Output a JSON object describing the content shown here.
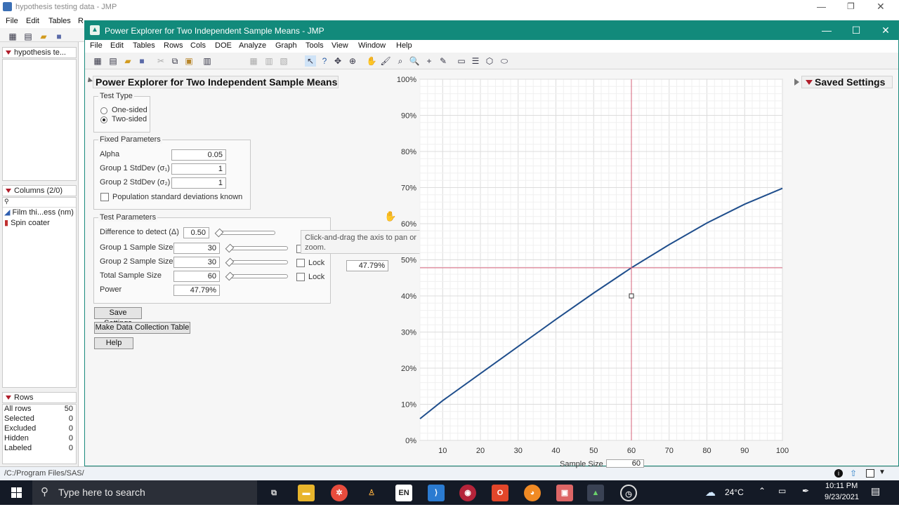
{
  "bg_window": {
    "title": "hypothesis testing data - JMP",
    "menu": [
      "File",
      "Edit",
      "Tables",
      "R"
    ],
    "left_panels": {
      "table_name": "hypothesis te...",
      "columns_header": "Columns (2/0)",
      "columns": [
        "Film thi...ess (nm)",
        "Spin coater"
      ],
      "rows_header": "Rows",
      "rows": [
        {
          "label": "All rows",
          "value": "50"
        },
        {
          "label": "Selected",
          "value": "0"
        },
        {
          "label": "Excluded",
          "value": "0"
        },
        {
          "label": "Hidden",
          "value": "0"
        },
        {
          "label": "Labeled",
          "value": "0"
        }
      ]
    },
    "status_path": "/C:/Program Files/SAS/"
  },
  "window": {
    "title": "Power Explorer for Two Independent Sample Means - JMP",
    "menu": [
      "File",
      "Edit",
      "Tables",
      "Rows",
      "Cols",
      "DOE",
      "Analyze",
      "Graph",
      "Tools",
      "View",
      "Window",
      "Help"
    ],
    "controls": {
      "minimize": "—",
      "maximize": "☐",
      "close": "✕"
    }
  },
  "report": {
    "title": "Power Explorer for Two Independent Sample Means",
    "test_type": {
      "title": "Test Type",
      "one_sided": "One-sided",
      "two_sided": "Two-sided",
      "selected": "Two-sided"
    },
    "fixed": {
      "title": "Fixed Parameters",
      "alpha_label": "Alpha",
      "alpha": "0.05",
      "sd1_label": "Group 1 StdDev (σ₁)",
      "sd1": "1",
      "sd2_label": "Group 2 StdDev (σ₂)",
      "sd2": "1",
      "known_label": "Population standard deviations known"
    },
    "test_params": {
      "title": "Test Parameters",
      "diff_label": "Difference to detect (Δ)",
      "diff": "0.50",
      "n1_label": "Group 1 Sample Size",
      "n1": "30",
      "n2_label": "Group 2 Sample Size",
      "n2": "30",
      "total_label": "Total Sample Size",
      "total": "60",
      "power_label": "Power",
      "power": "47.79%",
      "lock": "Lock"
    },
    "buttons": {
      "save": "Save Settings",
      "make": "Make Data Collection Table",
      "help": "Help"
    },
    "tooltip": "Click-and-drag the axis to pan or zoom.",
    "readout": "47.79%",
    "saved_settings": "Saved Settings"
  },
  "chart_data": {
    "type": "line",
    "xlabel": "Sample Size",
    "x_readout": "60",
    "xlim": [
      4,
      100
    ],
    "ylim": [
      0,
      100
    ],
    "x_ticks": [
      10,
      20,
      30,
      40,
      50,
      60,
      70,
      80,
      90,
      100
    ],
    "y_ticks": [
      "0%",
      "10%",
      "20%",
      "30%",
      "40%",
      "50%",
      "60%",
      "70%",
      "80%",
      "90%",
      "100%"
    ],
    "series": [
      {
        "x": [
          4,
          10,
          20,
          30,
          40,
          50,
          60,
          70,
          80,
          90,
          100
        ],
        "y": [
          6.0,
          11.0,
          18.5,
          26.0,
          33.5,
          40.8,
          47.8,
          54.2,
          60.2,
          65.4,
          69.8
        ]
      }
    ],
    "crosshair": {
      "x": 60,
      "y": 47.79
    },
    "colors": {
      "line": "#1f4e8c",
      "crosshair": "#d6607a"
    }
  },
  "taskbar": {
    "search_placeholder": "Type here to search",
    "weather": "24°C",
    "time": "10:11 PM",
    "date": "9/23/2021"
  }
}
